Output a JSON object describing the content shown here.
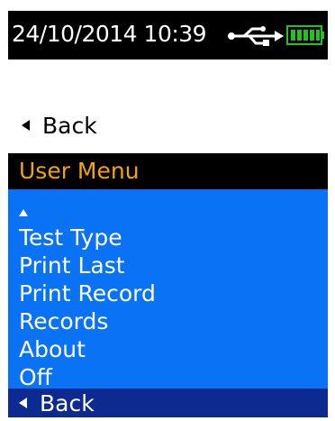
{
  "status": {
    "datetime": "24/10/2014 10:39"
  },
  "icons": {
    "usb": "usb-icon",
    "battery": "battery-full-icon",
    "back": "triangle-left-icon",
    "scroll_up": "triangle-up-icon"
  },
  "navigation": {
    "back_label": "Back"
  },
  "menu": {
    "title": "User Menu",
    "items": [
      "Test Type",
      "Print Last",
      "Print Record",
      "Records",
      "About",
      "Off"
    ]
  },
  "footer": {
    "back_label": "Back"
  },
  "colors": {
    "status_background": "#000000",
    "title_text": "#f2a30f",
    "menu_background": "#0a73f5",
    "footer_background": "#0c2a8f",
    "battery": "#22c21f"
  }
}
